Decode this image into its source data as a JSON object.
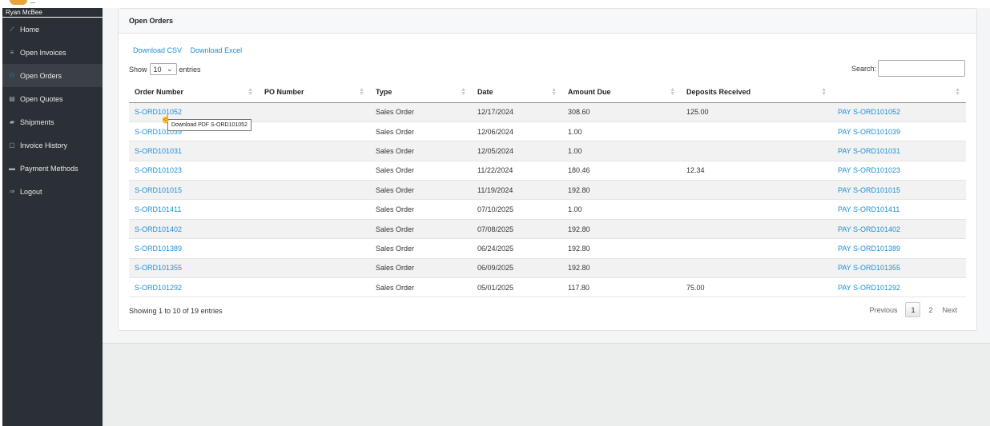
{
  "sidebar": {
    "user_name": "Ryan McBee",
    "items": [
      {
        "label": "Home",
        "icon": "chart-line-icon"
      },
      {
        "label": "Open Invoices",
        "icon": "list-icon"
      },
      {
        "label": "Open Orders",
        "icon": "users-icon",
        "active": true
      },
      {
        "label": "Open Quotes",
        "icon": "document-icon"
      },
      {
        "label": "Shipments",
        "icon": "truck-icon"
      },
      {
        "label": "Invoice History",
        "icon": "calendar-icon"
      },
      {
        "label": "Payment Methods",
        "icon": "credit-card-icon"
      },
      {
        "label": "Logout",
        "icon": "sign-out-icon"
      }
    ]
  },
  "card": {
    "title": "Open Orders",
    "download_csv": "Download CSV",
    "download_excel": "Download Excel",
    "show_label": "Show",
    "entries_value": "10",
    "entries_label": "entries",
    "search_label": "Search:"
  },
  "table": {
    "headers": [
      "Order Number",
      "PO Number",
      "Type",
      "Date",
      "Amount Due",
      "Deposits Received",
      ""
    ],
    "rows": [
      {
        "order": "S-ORD101052",
        "po": "",
        "type": "Sales Order",
        "date": "12/17/2024",
        "amount": "308.60",
        "deposits": "125.00",
        "pay": "PAY S-ORD101052"
      },
      {
        "order": "S-ORD101039",
        "po": "",
        "type": "Sales Order",
        "date": "12/06/2024",
        "amount": "1.00",
        "deposits": "",
        "pay": "PAY S-ORD101039"
      },
      {
        "order": "S-ORD101031",
        "po": "",
        "type": "Sales Order",
        "date": "12/05/2024",
        "amount": "1.00",
        "deposits": "",
        "pay": "PAY S-ORD101031"
      },
      {
        "order": "S-ORD101023",
        "po": "",
        "type": "Sales Order",
        "date": "11/22/2024",
        "amount": "180.46",
        "deposits": "12.34",
        "pay": "PAY S-ORD101023"
      },
      {
        "order": "S-ORD101015",
        "po": "",
        "type": "Sales Order",
        "date": "11/19/2024",
        "amount": "192.80",
        "deposits": "",
        "pay": "PAY S-ORD101015"
      },
      {
        "order": "S-ORD101411",
        "po": "",
        "type": "Sales Order",
        "date": "07/10/2025",
        "amount": "1.00",
        "deposits": "",
        "pay": "PAY S-ORD101411"
      },
      {
        "order": "S-ORD101402",
        "po": "",
        "type": "Sales Order",
        "date": "07/08/2025",
        "amount": "192.80",
        "deposits": "",
        "pay": "PAY S-ORD101402"
      },
      {
        "order": "S-ORD101389",
        "po": "",
        "type": "Sales Order",
        "date": "06/24/2025",
        "amount": "192.80",
        "deposits": "",
        "pay": "PAY S-ORD101389"
      },
      {
        "order": "S-ORD101355",
        "po": "",
        "type": "Sales Order",
        "date": "06/09/2025",
        "amount": "192.80",
        "deposits": "",
        "pay": "PAY S-ORD101355"
      },
      {
        "order": "S-ORD101292",
        "po": "",
        "type": "Sales Order",
        "date": "05/01/2025",
        "amount": "117.80",
        "deposits": "75.00",
        "pay": "PAY S-ORD101292"
      }
    ]
  },
  "tooltip": "Download PDF S-ORD101052",
  "footer": {
    "info": "Showing 1 to 10 of 19 entries",
    "previous": "Previous",
    "page1": "1",
    "page2": "2",
    "next": "Next"
  },
  "colors": {
    "link": "#1f8fd6",
    "sidebar_bg": "#2b3036",
    "accent_logo": "#e8a33c"
  }
}
